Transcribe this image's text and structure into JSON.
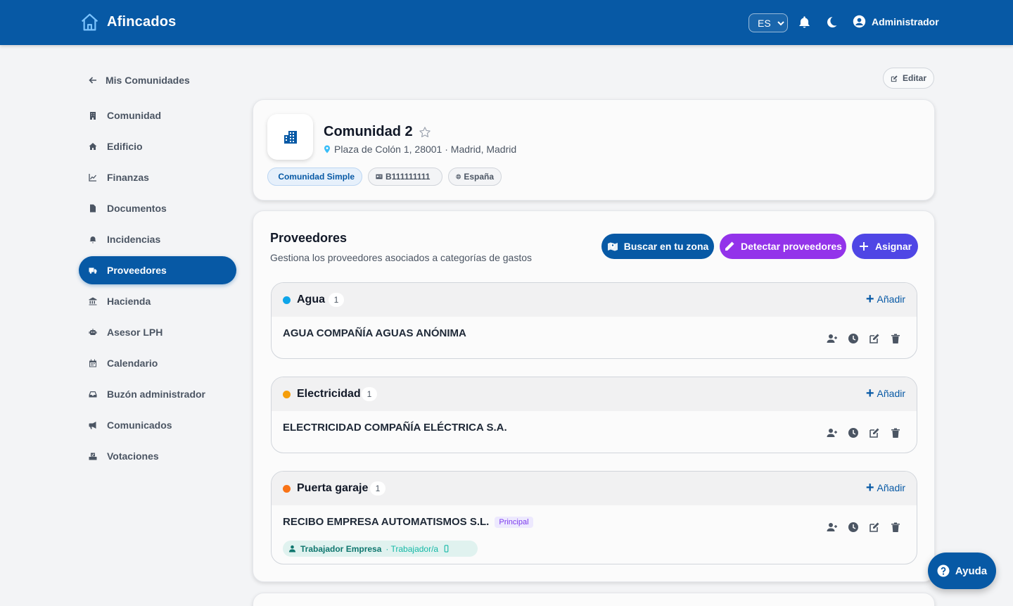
{
  "header": {
    "app_name": "Afincados",
    "language": "ES",
    "user_name": "Administrador"
  },
  "sidebar": {
    "back_label": "Mis Comunidades",
    "items": [
      {
        "label": "Comunidad",
        "icon": "building-icon"
      },
      {
        "label": "Edificio",
        "icon": "home-icon"
      },
      {
        "label": "Finanzas",
        "icon": "chart-line-icon"
      },
      {
        "label": "Documentos",
        "icon": "document-icon"
      },
      {
        "label": "Incidencias",
        "icon": "bell-icon"
      },
      {
        "label": "Proveedores",
        "icon": "truck-icon",
        "active": true
      },
      {
        "label": "Hacienda",
        "icon": "bank-icon"
      },
      {
        "label": "Asesor LPH",
        "icon": "robot-icon"
      },
      {
        "label": "Calendario",
        "icon": "calendar-icon"
      },
      {
        "label": "Buzón administrador",
        "icon": "inbox-icon"
      },
      {
        "label": "Comunicados",
        "icon": "megaphone-icon"
      },
      {
        "label": "Votaciones",
        "icon": "ballot-icon"
      }
    ]
  },
  "toolbar": {
    "edit_label": "Editar"
  },
  "community": {
    "name": "Comunidad 2",
    "address": "Plaza de Colón 1, 28001 · Madrid, Madrid",
    "type_chip": "Comunidad Simple",
    "cif_chip": "B111111111",
    "country_chip": "España"
  },
  "providers": {
    "title": "Proveedores",
    "subtitle": "Gestiona los proveedores asociados a categorías de gastos",
    "search_zone_label": "Buscar en tu zona",
    "detect_label": "Detectar proveedores",
    "assign_label": "Asignar",
    "add_label": "Añadir",
    "categories": [
      {
        "name": "Agua",
        "count": "1",
        "color": "#0ea5e9",
        "provider": "AGUA COMPAÑÍA AGUAS ANÓNIMA"
      },
      {
        "name": "Electricidad",
        "count": "1",
        "color": "#f59e0b",
        "provider": "ELECTRICIDAD COMPAÑÍA ELÉCTRICA S.A."
      },
      {
        "name": "Puerta garaje",
        "count": "1",
        "color": "#f97316",
        "provider": "RECIBO EMPRESA AUTOMATISMOS S.L.",
        "badge": "Principal",
        "worker_name": "Trabajador Empresa",
        "worker_role": "· Trabajador/a"
      }
    ]
  },
  "help": {
    "label": "Ayuda"
  },
  "colors": {
    "primary": "#0759a5",
    "purple": "#9333ea",
    "indigo": "#4f46e5"
  }
}
